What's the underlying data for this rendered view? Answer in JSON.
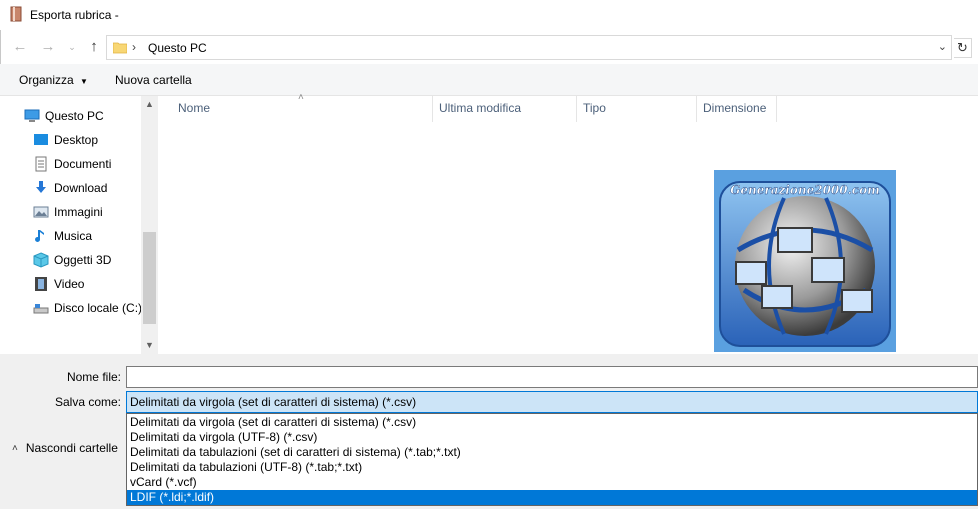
{
  "window": {
    "title": "Esporta rubrica -"
  },
  "address": {
    "path": "Questo PC"
  },
  "commands": {
    "organize": "Organizza",
    "new_folder": "Nuova cartella"
  },
  "nav": {
    "items": [
      {
        "label": "Questo PC",
        "icon": "computer-icon"
      },
      {
        "label": "Desktop",
        "icon": "desktop-icon"
      },
      {
        "label": "Documenti",
        "icon": "documents-icon"
      },
      {
        "label": "Download",
        "icon": "download-icon"
      },
      {
        "label": "Immagini",
        "icon": "pictures-icon"
      },
      {
        "label": "Musica",
        "icon": "music-icon"
      },
      {
        "label": "Oggetti 3D",
        "icon": "objects-3d-icon"
      },
      {
        "label": "Video",
        "icon": "video-icon"
      },
      {
        "label": "Disco locale (C:)",
        "icon": "local-disk-icon"
      }
    ]
  },
  "columns": {
    "name": "Nome",
    "modified": "Ultima modifica",
    "type": "Tipo",
    "size": "Dimensione"
  },
  "logo": {
    "text": "Generazione2000.com"
  },
  "form": {
    "filename_label": "Nome file:",
    "filename_value": "",
    "savetype_label": "Salva come:",
    "savetype_value": "Delimitati da virgola (set di caratteri di sistema) (*.csv)",
    "hide_folders": "Nascondi cartelle"
  },
  "savetype_options": [
    "Delimitati da virgola (set di caratteri di sistema) (*.csv)",
    "Delimitati da virgola (UTF-8) (*.csv)",
    "Delimitati da tabulazioni (set di caratteri di sistema) (*.tab;*.txt)",
    "Delimitati da tabulazioni (UTF-8) (*.tab;*.txt)",
    "vCard (*.vcf)",
    "LDIF (*.ldi;*.ldif)"
  ],
  "selected_option": "LDIF (*.ldi;*.ldif)",
  "colors": {
    "accent": "#0078d7",
    "selection_bg": "#cce4f7",
    "header_text": "#4c607a"
  }
}
